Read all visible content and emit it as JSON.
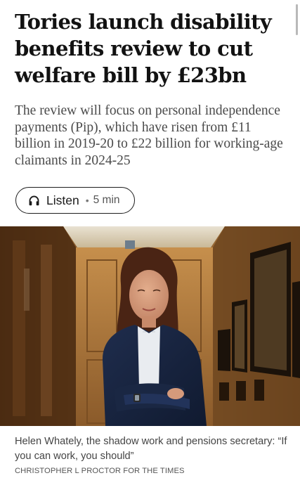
{
  "article": {
    "headline": "Tories launch disability benefits review to cut welfare bill by £23bn",
    "standfirst": "The review will focus on personal independence payments (Pip), which have risen from £11 billion in 2019-20 to £22 billion for working-age claimants in 2024-25"
  },
  "listen": {
    "icon": "headphones-icon",
    "label": "Listen",
    "separator": "•",
    "duration": "5 min"
  },
  "photo": {
    "caption": "Helen Whately, the shadow work and pensions secretary: “If you can work, you should”",
    "credit": "CHRISTOPHER L PROCTOR FOR THE TIMES"
  }
}
